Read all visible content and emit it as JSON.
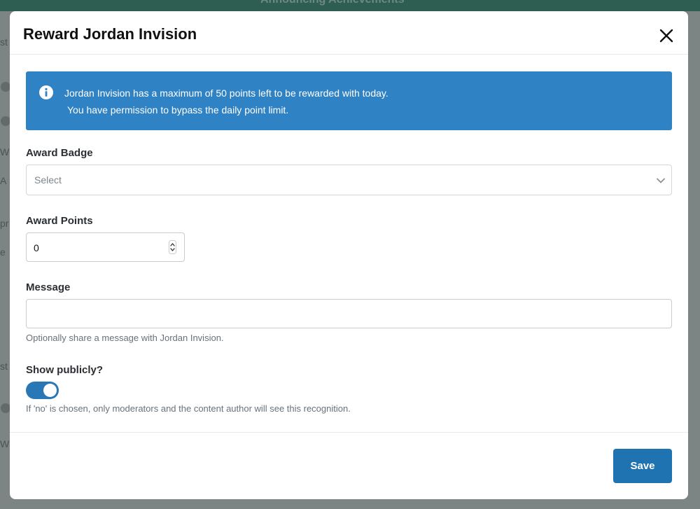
{
  "background": {
    "header_text": "Announcing Achievements",
    "fragments": [
      "st",
      "W",
      "A",
      "pr",
      "e",
      "st",
      "W"
    ]
  },
  "modal": {
    "title": "Reward Jordan Invision",
    "close_icon": "close-icon",
    "alert": {
      "icon": "info-circle-icon",
      "line1": "Jordan Invision has a maximum of 50 points left to be rewarded with today.",
      "line2": "You have permission to bypass the daily point limit."
    },
    "badge": {
      "label": "Award Badge",
      "selected": "Select"
    },
    "points": {
      "label": "Award Points",
      "value": "0"
    },
    "message": {
      "label": "Message",
      "value": "",
      "help": "Optionally share a message with Jordan Invision."
    },
    "show_publicly": {
      "label": "Show publicly?",
      "enabled": true,
      "help": "If 'no' is chosen, only moderators and the content author will see this recognition."
    },
    "save_label": "Save"
  },
  "colors": {
    "alert_bg": "#2f82c4",
    "primary": "#1f73b0",
    "toggle_on": "#2a77b5"
  }
}
